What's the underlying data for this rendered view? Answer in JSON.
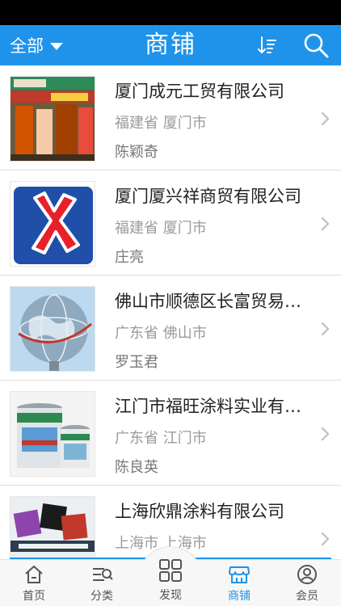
{
  "header": {
    "filter_label": "全部",
    "title": "商铺",
    "sort_icon": "sort-icon",
    "search_icon": "search-icon",
    "accent_color": "#1f93ea"
  },
  "shops": [
    {
      "name": "厦门成元工贸有限公司",
      "region": "福建省 厦门市",
      "contact": "陈颖奇",
      "image": "storefront-photo"
    },
    {
      "name": "厦门厦兴祥商贸有限公司",
      "region": "福建省 厦门市",
      "contact": "庄亮",
      "image": "red-x-logo"
    },
    {
      "name": "佛山市顺德区长富贸易有限公司",
      "region": "广东省 佛山市",
      "contact": "罗玉君",
      "image": "globe-photo"
    },
    {
      "name": "江门市福旺涂料实业有限公司",
      "region": "广东省 江门市",
      "contact": "陈良英",
      "image": "paint-cans-photo"
    },
    {
      "name": "上海欣鼎涂料有限公司",
      "region": "上海市 上海市",
      "contact": "",
      "image": "paint-brand-photo"
    }
  ],
  "tabbar": {
    "tabs": [
      {
        "label": "首页",
        "icon": "home-icon"
      },
      {
        "label": "分类",
        "icon": "category-icon"
      },
      {
        "label": "发现",
        "icon": "grid-icon"
      },
      {
        "label": "商铺",
        "icon": "shop-icon",
        "active": true
      },
      {
        "label": "会员",
        "icon": "user-icon"
      }
    ]
  }
}
